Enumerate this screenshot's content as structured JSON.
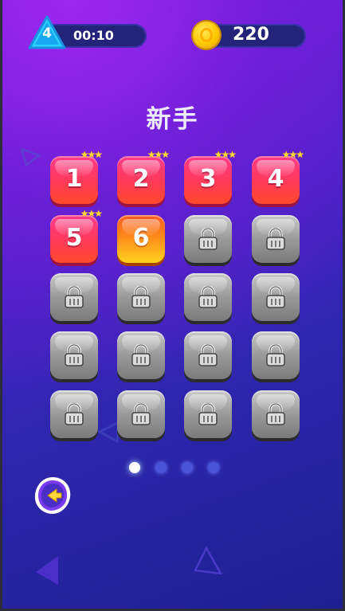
{
  "header": {
    "level_number": "4",
    "timer": "00:10",
    "coins": "220"
  },
  "title": "新手",
  "levels": [
    {
      "label": "1",
      "state": "done",
      "stars": "★★★"
    },
    {
      "label": "2",
      "state": "done",
      "stars": "★★★"
    },
    {
      "label": "3",
      "state": "done",
      "stars": "★★★"
    },
    {
      "label": "4",
      "state": "done",
      "stars": "★★★"
    },
    {
      "label": "5",
      "state": "done",
      "stars": "★★★"
    },
    {
      "label": "6",
      "state": "current",
      "stars": ""
    },
    {
      "label": "",
      "state": "locked"
    },
    {
      "label": "",
      "state": "locked"
    },
    {
      "label": "",
      "state": "locked"
    },
    {
      "label": "",
      "state": "locked"
    },
    {
      "label": "",
      "state": "locked"
    },
    {
      "label": "",
      "state": "locked"
    },
    {
      "label": "",
      "state": "locked"
    },
    {
      "label": "",
      "state": "locked"
    },
    {
      "label": "",
      "state": "locked"
    },
    {
      "label": "",
      "state": "locked"
    },
    {
      "label": "",
      "state": "locked"
    },
    {
      "label": "",
      "state": "locked"
    },
    {
      "label": "",
      "state": "locked"
    },
    {
      "label": "",
      "state": "locked"
    }
  ],
  "pagination": {
    "pages": 4,
    "current": 1
  },
  "icons": {
    "level": "triangle-badge-icon",
    "coin": "coin-icon",
    "lock": "padlock-icon",
    "back": "back-arrow-icon"
  },
  "colors": {
    "accent_done": "#ff3a58",
    "accent_current": "#ff8a1a",
    "locked": "#9a9a9a",
    "star": "#ffd83a"
  }
}
